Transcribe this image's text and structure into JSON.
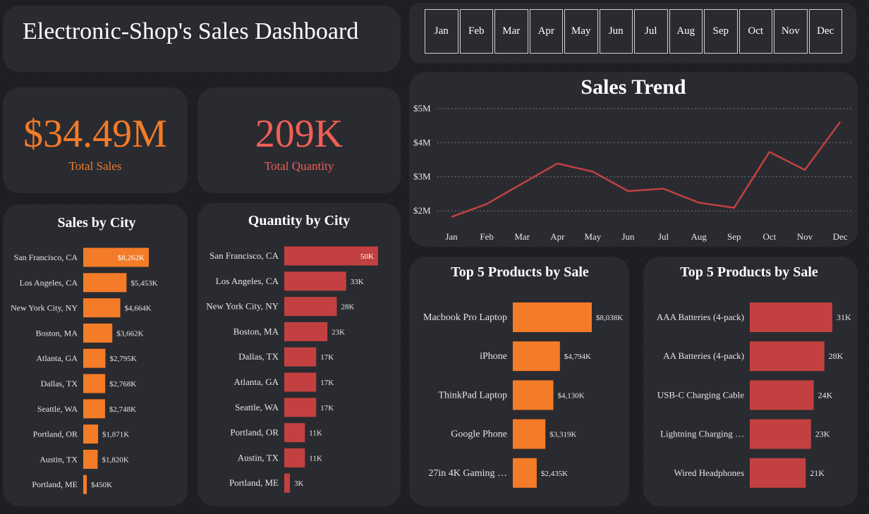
{
  "header": {
    "title": "Electronic-Shop's Sales Dashboard"
  },
  "month_slicer": [
    "Jan",
    "Feb",
    "Mar",
    "Apr",
    "May",
    "Jun",
    "Jul",
    "Aug",
    "Sep",
    "Oct",
    "Nov",
    "Dec"
  ],
  "kpis": {
    "total_sales": {
      "value": "$34.49M",
      "label": "Total Sales",
      "color": "#f47b27"
    },
    "total_quantity": {
      "value": "209K",
      "label": "Total Quantity",
      "color": "#ef5f57"
    }
  },
  "colors": {
    "orange": "#f47b27",
    "red": "#c24140",
    "card": "#2a2b30"
  },
  "chart_data": [
    {
      "id": "sales_by_city",
      "type": "bar",
      "orientation": "horizontal",
      "title": "Sales by City",
      "categories": [
        "San Francisco, CA",
        "Los Angeles, CA",
        "New York City, NY",
        "Boston, MA",
        "Atlanta, GA",
        "Dallas, TX",
        "Seattle, WA",
        "Portland, OR",
        "Austin, TX",
        "Portland, ME"
      ],
      "values": [
        8262,
        5453,
        4664,
        3662,
        2795,
        2768,
        2748,
        1871,
        1820,
        450
      ],
      "value_labels": [
        "$8,262K",
        "$5,453K",
        "$4,664K",
        "$3,662K",
        "$2,795K",
        "$2,768K",
        "$2,748K",
        "$1,871K",
        "$1,820K",
        "$450K"
      ],
      "color": "#f47b27"
    },
    {
      "id": "quantity_by_city",
      "type": "bar",
      "orientation": "horizontal",
      "title": "Quantity by City",
      "categories": [
        "San Francisco, CA",
        "Los Angeles, CA",
        "New York City, NY",
        "Boston, MA",
        "Dallas, TX",
        "Atlanta, GA",
        "Seattle, WA",
        "Portland, OR",
        "Austin, TX",
        "Portland, ME"
      ],
      "values": [
        50,
        33,
        28,
        23,
        17,
        17,
        17,
        11,
        11,
        3
      ],
      "value_labels": [
        "50K",
        "33K",
        "28K",
        "23K",
        "17K",
        "17K",
        "17K",
        "11K",
        "11K",
        "3K"
      ],
      "color": "#c24140"
    },
    {
      "id": "sales_trend",
      "type": "line",
      "title": "Sales Trend",
      "x": [
        "Jan",
        "Feb",
        "Mar",
        "Apr",
        "May",
        "Jun",
        "Jul",
        "Aug",
        "Sep",
        "Oct",
        "Nov",
        "Dec"
      ],
      "y": [
        1.82,
        2.2,
        2.8,
        3.39,
        3.15,
        2.58,
        2.65,
        2.24,
        2.09,
        3.73,
        3.2,
        4.61
      ],
      "y_unit": "$M",
      "yticks": [
        2,
        3,
        4,
        5
      ],
      "ytick_labels": [
        "$2M",
        "$3M",
        "$4M",
        "$5M"
      ],
      "ylim": [
        1.7,
        5.15
      ],
      "grid": true,
      "color": "#c24140"
    },
    {
      "id": "top5_products_sales",
      "type": "bar",
      "orientation": "horizontal",
      "title": "Top 5 Products by Sale",
      "categories": [
        "Macbook Pro Laptop",
        "iPhone",
        "ThinkPad Laptop",
        "Google Phone",
        "27in 4K Gaming …"
      ],
      "values": [
        8038,
        4794,
        4130,
        3319,
        2435
      ],
      "value_labels": [
        "$8,038K",
        "$4,794K",
        "$4,130K",
        "$3,319K",
        "$2,435K"
      ],
      "color": "#f47b27"
    },
    {
      "id": "top5_products_quantity",
      "type": "bar",
      "orientation": "horizontal",
      "title": "Top 5 Products by Sale",
      "categories": [
        "AAA Batteries (4-pack)",
        "AA Batteries (4-pack)",
        "USB-C Charging Cable",
        "Lightning Charging …",
        "Wired Headphones"
      ],
      "values": [
        31,
        28,
        24,
        23,
        21
      ],
      "value_labels": [
        "31K",
        "28K",
        "24K",
        "23K",
        "21K"
      ],
      "color": "#c24140"
    }
  ]
}
